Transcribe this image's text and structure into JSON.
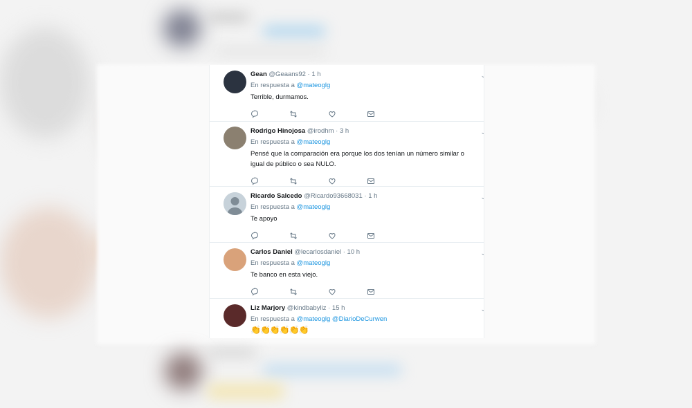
{
  "tweets": [
    {
      "name": "Gean",
      "handle": "@Geaans92",
      "dot": "·",
      "time": "1 h",
      "reply_prefix": "En respuesta a",
      "reply_to": "@mateoglg",
      "reply_to2": "",
      "text": "Terrible, durmamos.",
      "avatar_color": "#2b3340"
    },
    {
      "name": "Rodrigo Hinojosa",
      "handle": "@irodhm",
      "dot": "·",
      "time": "3 h",
      "reply_prefix": "En respuesta a",
      "reply_to": "@mateoglg",
      "reply_to2": "",
      "text": "Pensé que la comparación era porque los dos tenían un número similar o igual de público o sea NULO.",
      "avatar_color": "#8b8070"
    },
    {
      "name": "Ricardo Salcedo",
      "handle": "@Ricardo93668031",
      "dot": "·",
      "time": "1 h",
      "reply_prefix": "En respuesta a",
      "reply_to": "@mateoglg",
      "reply_to2": "",
      "text": "Te apoyo",
      "avatar_color": "#c7d2da"
    },
    {
      "name": "Carlos Daniel",
      "handle": "@lecarlosdaniel",
      "dot": "·",
      "time": "10 h",
      "reply_prefix": "En respuesta a",
      "reply_to": "@mateoglg",
      "reply_to2": "",
      "text": "Te banco en esta viejo.",
      "avatar_color": "#d9a27a"
    },
    {
      "name": "Liz Marjory",
      "handle": "@kindbabyliz",
      "dot": "·",
      "time": "15 h",
      "reply_prefix": "En respuesta a",
      "reply_to": "@mateoglg",
      "reply_to2": "@DiarioDeCurwen",
      "text": "👏👏👏👏👏👏",
      "avatar_color": "#5a2a2a"
    }
  ],
  "colors": {
    "link": "#1b95e0",
    "muted": "#657786",
    "icon": "#657786"
  },
  "icons": [
    "reply-icon",
    "retweet-icon",
    "like-icon",
    "dm-icon",
    "chevron-down-icon"
  ]
}
